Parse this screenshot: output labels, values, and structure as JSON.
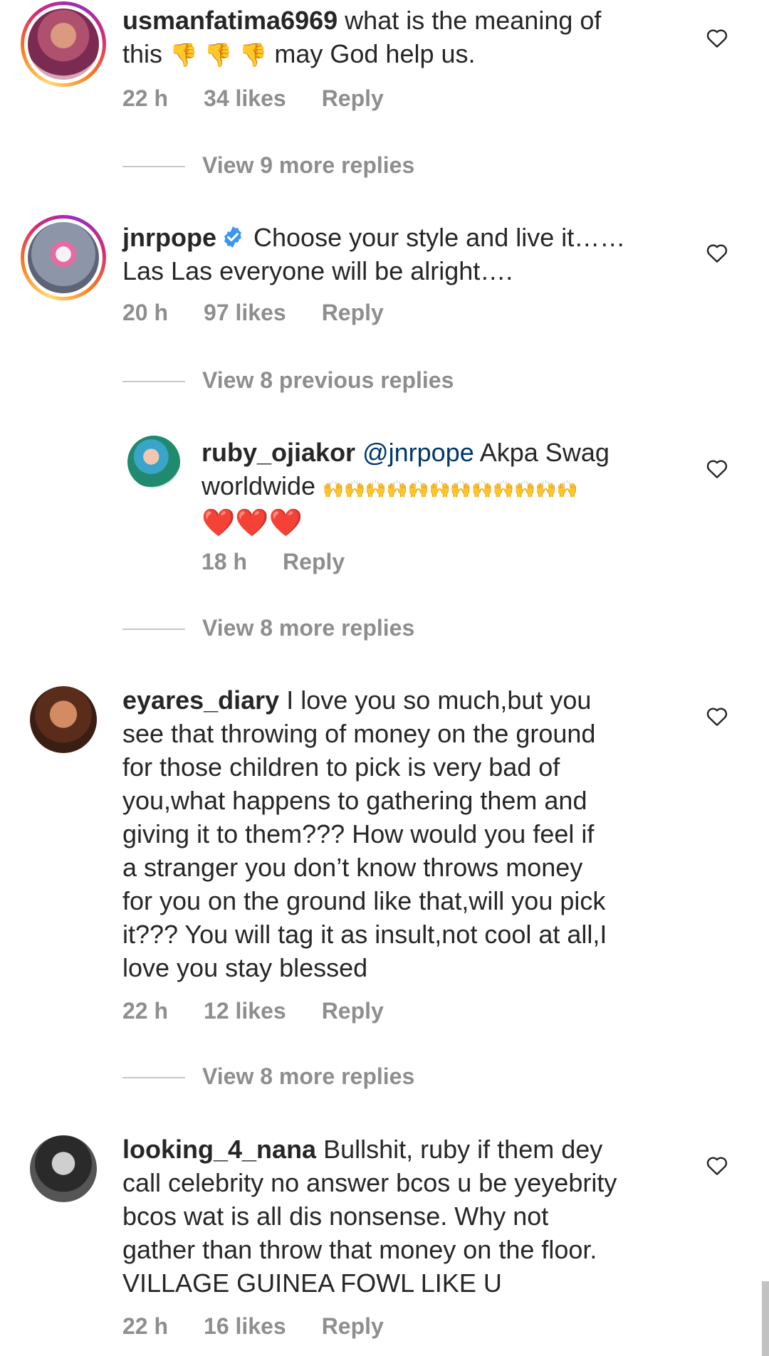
{
  "comments": [
    {
      "username": "usmanfatima6969",
      "text_a": "what is the meaning of",
      "text_b": "this",
      "emojis": "👎 👎 👎",
      "text_c": "may God help us.",
      "time": "22 h",
      "likes": "34 likes",
      "reply": "Reply",
      "avatar_icon": "profile-photo"
    },
    {
      "view": "View 9 more replies"
    },
    {
      "username": "jnrpope",
      "verified_icon": "verified-badge-icon",
      "text_a": "Choose your style and live it……",
      "text_b": "Las Las everyone will be alright….",
      "time": "20 h",
      "likes": "97 likes",
      "reply": "Reply"
    },
    {
      "view": "View 8 previous replies"
    },
    {
      "username": "ruby_ojiakor",
      "mention": "@jnrpope",
      "text_a": "Akpa Swag",
      "text_b": "worldwide",
      "emojis_a": "🙌🙌🙌🙌🙌🙌🙌🙌🙌🙌🙌🙌",
      "emojis_b": "❤️❤️❤️",
      "time": "18 h",
      "reply": "Reply"
    },
    {
      "view": "View 8 more replies"
    },
    {
      "username": "eyares_diary",
      "text": "I love you so much,but you\nsee that throwing of money on the ground\nfor those children to pick is very bad of\nyou,what happens to gathering them and\ngiving it to them??? How would you feel if\na stranger you don’t know throws money\nfor you on the ground like that,will you pick\nit??? You will tag it as insult,not cool at all,I\nlove you stay blessed",
      "time": "22 h",
      "likes": "12 likes",
      "reply": "Reply"
    },
    {
      "view": "View 8 more replies"
    },
    {
      "username": "looking_4_nana",
      "text": "Bullshit, ruby if them dey\ncall celebrity no answer bcos u be yeyebrity\nbcos wat is all dis nonsense. Why not\ngather than throw that money on the floor.\nVILLAGE GUINEA FOWL LIKE U",
      "time": "22 h",
      "likes": "16 likes",
      "reply": "Reply"
    }
  ],
  "colors": {
    "text": "#262626",
    "meta": "#8e8e8e",
    "mention": "#00376b",
    "verified": "#3897f0"
  }
}
